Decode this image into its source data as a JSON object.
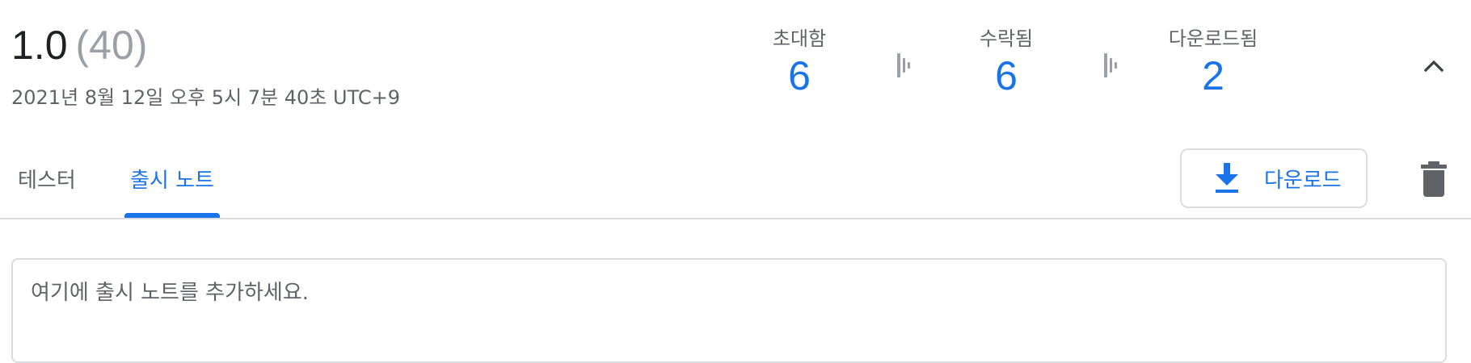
{
  "release": {
    "version": "1.0",
    "count": "(40)",
    "timestamp": "2021년 8월 12일 오후 5시 7분 40초 UTC+9"
  },
  "stats": {
    "invited": {
      "label": "초대함",
      "value": "6"
    },
    "accepted": {
      "label": "수락됨",
      "value": "6"
    },
    "downloaded": {
      "label": "다운로드됨",
      "value": "2"
    }
  },
  "tabs": [
    {
      "label": "테스터",
      "active": false
    },
    {
      "label": "출시 노트",
      "active": true
    }
  ],
  "actions": {
    "download_label": "다운로드"
  },
  "notes": {
    "placeholder": "여기에 출시 노트를 추가하세요."
  },
  "icons": {
    "collapse": "chevron-up-icon",
    "funnel": "funnel-arrow-icon",
    "download": "download-icon",
    "delete": "delete-icon"
  },
  "colors": {
    "accent": "#1a73e8",
    "text_primary": "#202124",
    "text_secondary": "#5f6368",
    "muted": "#9aa0a6",
    "border": "#dadce0"
  }
}
